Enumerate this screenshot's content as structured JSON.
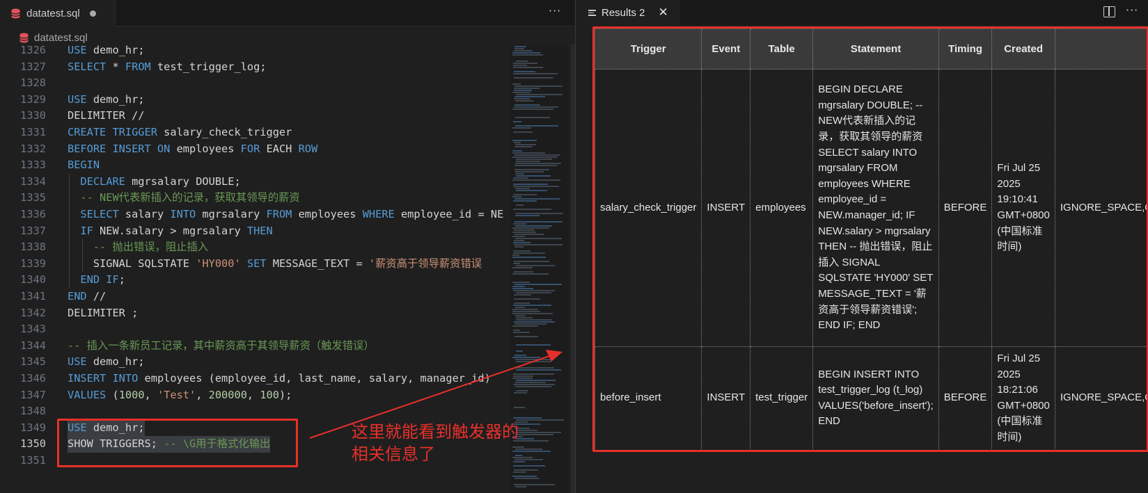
{
  "editor": {
    "tab_title": "datatest.sql",
    "breadcrumb_file": "datatest.sql",
    "lines": [
      {
        "n": "1326",
        "tokens": [
          [
            "kw",
            "USE"
          ],
          [
            "t",
            " demo_hr;"
          ]
        ]
      },
      {
        "n": "1327",
        "tokens": [
          [
            "kw",
            "SELECT"
          ],
          [
            "t",
            " * "
          ],
          [
            "kw",
            "FROM"
          ],
          [
            "t",
            " test_trigger_log;"
          ]
        ]
      },
      {
        "n": "1328",
        "tokens": []
      },
      {
        "n": "1329",
        "tokens": [
          [
            "kw",
            "USE"
          ],
          [
            "t",
            " demo_hr;"
          ]
        ]
      },
      {
        "n": "1330",
        "tokens": [
          [
            "t",
            "DELIMITER //"
          ]
        ]
      },
      {
        "n": "1331",
        "tokens": [
          [
            "kw",
            "CREATE TRIGGER"
          ],
          [
            "t",
            " salary_check_trigger"
          ]
        ]
      },
      {
        "n": "1332",
        "tokens": [
          [
            "kw",
            "BEFORE INSERT ON"
          ],
          [
            "t",
            " employees "
          ],
          [
            "kw",
            "FOR"
          ],
          [
            "t",
            " EACH "
          ],
          [
            "kw",
            "ROW"
          ]
        ]
      },
      {
        "n": "1333",
        "tokens": [
          [
            "kw",
            "BEGIN"
          ]
        ]
      },
      {
        "n": "1334",
        "tokens": [
          [
            "t",
            "  "
          ],
          [
            "kw",
            "DECLARE"
          ],
          [
            "t",
            " mgrsalary DOUBLE;"
          ]
        ]
      },
      {
        "n": "1335",
        "tokens": [
          [
            "cm",
            "  -- NEW代表新插入的记录，获取其领导的薪资"
          ]
        ]
      },
      {
        "n": "1336",
        "tokens": [
          [
            "t",
            "  "
          ],
          [
            "kw",
            "SELECT"
          ],
          [
            "t",
            " salary "
          ],
          [
            "kw",
            "INTO"
          ],
          [
            "t",
            " mgrsalary "
          ],
          [
            "kw",
            "FROM"
          ],
          [
            "t",
            " employees "
          ],
          [
            "kw",
            "WHERE"
          ],
          [
            "t",
            " employee_id = NE"
          ]
        ]
      },
      {
        "n": "1337",
        "tokens": [
          [
            "t",
            "  "
          ],
          [
            "kw",
            "IF"
          ],
          [
            "t",
            " NEW.salary > mgrsalary "
          ],
          [
            "kw",
            "THEN"
          ]
        ]
      },
      {
        "n": "1338",
        "tokens": [
          [
            "cm",
            "    -- 抛出错误，阻止插入"
          ]
        ]
      },
      {
        "n": "1339",
        "tokens": [
          [
            "t",
            "    SIGNAL SQLSTATE "
          ],
          [
            "str",
            "'HY000'"
          ],
          [
            "t",
            " "
          ],
          [
            "kw",
            "SET"
          ],
          [
            "t",
            " MESSAGE_TEXT = "
          ],
          [
            "str",
            "'薪资高于领导薪资错误"
          ]
        ]
      },
      {
        "n": "1340",
        "tokens": [
          [
            "t",
            "  "
          ],
          [
            "kw",
            "END IF"
          ],
          [
            "t",
            ";"
          ]
        ]
      },
      {
        "n": "1341",
        "tokens": [
          [
            "kw",
            "END"
          ],
          [
            "t",
            " //"
          ]
        ]
      },
      {
        "n": "1342",
        "tokens": [
          [
            "t",
            "DELIMITER ;"
          ]
        ]
      },
      {
        "n": "1343",
        "tokens": []
      },
      {
        "n": "1344",
        "tokens": [
          [
            "cm",
            "-- 插入一条新员工记录，其中薪资高于其领导薪资（触发错误）"
          ]
        ]
      },
      {
        "n": "1345",
        "tokens": [
          [
            "kw",
            "USE"
          ],
          [
            "t",
            " demo_hr;"
          ]
        ]
      },
      {
        "n": "1346",
        "tokens": [
          [
            "kw",
            "INSERT INTO"
          ],
          [
            "t",
            " employees (employee_id, last_name, salary, manager_id)"
          ]
        ]
      },
      {
        "n": "1347",
        "tokens": [
          [
            "kw",
            "VALUES"
          ],
          [
            "t",
            " ("
          ],
          [
            "num",
            "1000"
          ],
          [
            "t",
            ", "
          ],
          [
            "str",
            "'Test'"
          ],
          [
            "t",
            ", "
          ],
          [
            "num",
            "200000"
          ],
          [
            "t",
            ", "
          ],
          [
            "num",
            "100"
          ],
          [
            "t",
            ");"
          ]
        ]
      },
      {
        "n": "1348",
        "tokens": []
      },
      {
        "n": "1349",
        "tokens": [
          [
            "kw",
            "USE"
          ],
          [
            "t",
            " demo_hr;"
          ]
        ],
        "selected": true
      },
      {
        "n": "1350",
        "tokens": [
          [
            "t",
            "SHOW TRIGGERS; "
          ],
          [
            "cm",
            "-- \\G用于格式化输出"
          ]
        ],
        "selected": true,
        "current": true
      },
      {
        "n": "1351",
        "tokens": []
      }
    ]
  },
  "annotation": {
    "line1": "这里就能看到触发器的",
    "line2": "相关信息了"
  },
  "results": {
    "tab_label": "Results 2",
    "columns": [
      "Trigger",
      "Event",
      "Table",
      "Statement",
      "Timing",
      "Created",
      ""
    ],
    "rows": [
      {
        "trigger": "salary_check_trigger",
        "event": "INSERT",
        "table": "employees",
        "statement": "BEGIN DECLARE mgrsalary DOUBLE; -- NEW代表新插入的记录，获取其领导的薪资 SELECT salary INTO mgrsalary FROM employees WHERE employee_id = NEW.manager_id; IF NEW.salary > mgrsalary THEN -- 抛出错误，阻止插入 SIGNAL SQLSTATE 'HY000' SET MESSAGE_TEXT = '薪资高于领导薪资错误'; END IF; END",
        "timing": "BEFORE",
        "created": "Fri Jul 25 2025 19:10:41 GMT+0800 (中国标准时间)",
        "sql_mode": "IGNORE_SPACE,ONLY_"
      },
      {
        "trigger": "before_insert",
        "event": "INSERT",
        "table": "test_trigger",
        "statement": "BEGIN INSERT INTO test_trigger_log (t_log) VALUES('before_insert'); END",
        "timing": "BEFORE",
        "created": "Fri Jul 25 2025 18:21:06 GMT+0800 (中国标准时间)",
        "sql_mode": "IGNORE_SPACE,ONLY_"
      }
    ]
  },
  "colors": {
    "annotation_red": "#e8302a",
    "keyword_blue": "#569cd6",
    "comment_green": "#6a9955",
    "string_orange": "#ce9178"
  }
}
